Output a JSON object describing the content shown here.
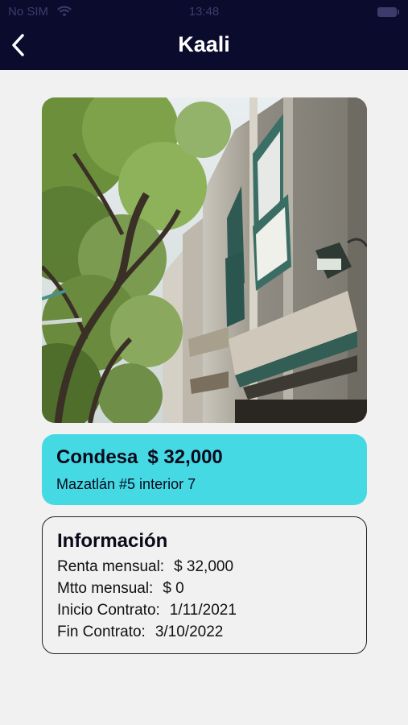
{
  "status_bar": {
    "carrier": "No SIM",
    "time": "13:48"
  },
  "header": {
    "title": "Kaali",
    "back_icon": "chevron-left-icon"
  },
  "photo": {
    "subject": "building-facade-photo"
  },
  "property": {
    "neighborhood": "Condesa",
    "price": "$ 32,000",
    "address": "Mazatlán #5 interior 7",
    "card_color": "#45d9e4"
  },
  "info": {
    "title": "Información",
    "rows": [
      {
        "label": "Renta mensual:",
        "value": "$ 32,000"
      },
      {
        "label": "Mtto mensual:",
        "value": "$ 0"
      },
      {
        "label": "Inicio Contrato:",
        "value": "1/11/2021"
      },
      {
        "label": "Fin Contrato:",
        "value": "3/10/2022"
      }
    ]
  },
  "colors": {
    "header_bg": "#0b0b2e",
    "page_bg": "#f1f1f1"
  }
}
